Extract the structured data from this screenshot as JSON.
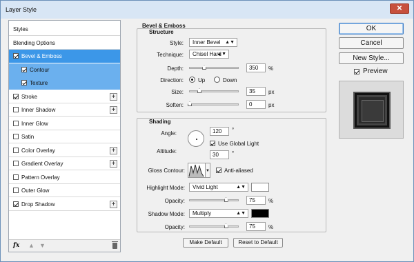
{
  "window": {
    "title": "Layer Style",
    "close_glyph": "✕"
  },
  "sidebar": {
    "items": [
      {
        "label": "Styles",
        "checkbox": null,
        "checked": false,
        "plus": false,
        "state": "normal"
      },
      {
        "label": "Blending Options",
        "checkbox": null,
        "checked": false,
        "plus": false,
        "state": "normal"
      },
      {
        "label": "Bevel & Emboss",
        "checkbox": true,
        "checked": true,
        "plus": false,
        "state": "selected"
      },
      {
        "label": "Contour",
        "checkbox": true,
        "checked": true,
        "plus": false,
        "state": "sub"
      },
      {
        "label": "Texture",
        "checkbox": true,
        "checked": true,
        "plus": false,
        "state": "sub"
      },
      {
        "label": "Stroke",
        "checkbox": true,
        "checked": true,
        "plus": true,
        "state": "normal"
      },
      {
        "label": "Inner Shadow",
        "checkbox": true,
        "checked": false,
        "plus": true,
        "state": "normal"
      },
      {
        "label": "Inner Glow",
        "checkbox": true,
        "checked": false,
        "plus": false,
        "state": "normal"
      },
      {
        "label": "Satin",
        "checkbox": true,
        "checked": false,
        "plus": false,
        "state": "normal"
      },
      {
        "label": "Color Overlay",
        "checkbox": true,
        "checked": false,
        "plus": true,
        "state": "normal"
      },
      {
        "label": "Gradient Overlay",
        "checkbox": true,
        "checked": false,
        "plus": true,
        "state": "normal"
      },
      {
        "label": "Pattern Overlay",
        "checkbox": true,
        "checked": false,
        "plus": false,
        "state": "normal"
      },
      {
        "label": "Outer Glow",
        "checkbox": true,
        "checked": false,
        "plus": false,
        "state": "normal"
      },
      {
        "label": "Drop Shadow",
        "checkbox": true,
        "checked": true,
        "plus": true,
        "state": "normal"
      }
    ],
    "footer": {
      "fx": "fx",
      "up": "▲",
      "down": "▼"
    }
  },
  "bevel": {
    "section_title": "Bevel & Emboss",
    "structure_title": "Structure",
    "style_label": "Style:",
    "style_value": "Inner Bevel",
    "technique_label": "Technique:",
    "technique_value": "Chisel Hard",
    "depth_label": "Depth:",
    "depth_value": "350",
    "depth_unit": "%",
    "depth_slider": 0.3,
    "direction_label": "Direction:",
    "direction_up": "Up",
    "direction_down": "Down",
    "direction_selected": "Up",
    "size_label": "Size:",
    "size_value": "35",
    "size_unit": "px",
    "size_slider": 0.2,
    "soften_label": "Soften:",
    "soften_value": "0",
    "soften_unit": "px",
    "soften_slider": 0.0
  },
  "shading": {
    "title": "Shading",
    "angle_label": "Angle:",
    "angle_value": "120",
    "angle_unit": "°",
    "global_light_label": "Use Global Light",
    "global_light_checked": true,
    "altitude_label": "Altitude:",
    "altitude_value": "30",
    "altitude_unit": "°",
    "gloss_label": "Gloss Contour:",
    "antialias_label": "Anti-aliased",
    "antialias_checked": true,
    "highlight_label": "Highlight Mode:",
    "highlight_value": "Vivid Light",
    "highlight_color": "#ffffff",
    "opacity_label": "Opacity:",
    "highlight_opacity": "75",
    "highlight_opacity_slider": 0.75,
    "opacity_unit": "%",
    "shadow_label": "Shadow Mode:",
    "shadow_value": "Multiply",
    "shadow_color": "#000000",
    "shadow_opacity": "75",
    "shadow_opacity_slider": 0.75
  },
  "buttons": {
    "make_default": "Make Default",
    "reset_default": "Reset to Default"
  },
  "right": {
    "ok": "OK",
    "cancel": "Cancel",
    "new_style": "New Style...",
    "preview_label": "Preview",
    "preview_checked": true
  },
  "colors": {
    "selected": "#3c97e8",
    "sub": "#6bb0ee",
    "titlebar": "#d8e6f5",
    "close": "#c7503d"
  }
}
